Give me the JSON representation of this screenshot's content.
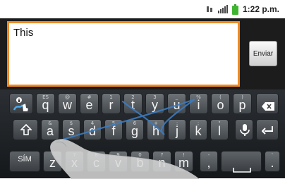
{
  "status_bar": {
    "time": "1:22 p.m."
  },
  "compose": {
    "message_text": "This",
    "send_label": "Enviar"
  },
  "keyboard": {
    "row1": [
      {
        "id": "q",
        "main": "q",
        "alt": "ES"
      },
      {
        "id": "w",
        "main": "w",
        "alt": "@"
      },
      {
        "id": "e",
        "main": "e",
        "alt": "#"
      },
      {
        "id": "r",
        "main": "r",
        "alt": "1"
      },
      {
        "id": "t",
        "main": "t",
        "alt": "2"
      },
      {
        "id": "y",
        "main": "y",
        "alt": "3"
      },
      {
        "id": "u",
        "main": "u",
        "alt": "_"
      },
      {
        "id": "i",
        "main": "i",
        "alt": "%"
      },
      {
        "id": "o",
        "main": "o",
        "alt": "("
      },
      {
        "id": "p",
        "main": "p",
        "alt": ")"
      }
    ],
    "row2": [
      {
        "id": "a",
        "main": "a",
        "alt": "&"
      },
      {
        "id": "s",
        "main": "s",
        "alt": "$"
      },
      {
        "id": "d",
        "main": "d",
        "alt": "4"
      },
      {
        "id": "f",
        "main": "f",
        "alt": "5"
      },
      {
        "id": "g",
        "main": "g",
        "alt": "6"
      },
      {
        "id": "h",
        "main": "h",
        "alt": "+"
      },
      {
        "id": "j",
        "main": "j",
        "alt": ":"
      },
      {
        "id": "k",
        "main": "k",
        "alt": ";"
      },
      {
        "id": "l",
        "main": "l",
        "alt": "\""
      }
    ],
    "row3": [
      {
        "id": "z",
        "main": "z",
        "alt": ""
      },
      {
        "id": "x",
        "main": "x",
        "alt": "7"
      },
      {
        "id": "c",
        "main": "c",
        "alt": "8"
      },
      {
        "id": "v",
        "main": "v",
        "alt": "9"
      },
      {
        "id": "b",
        "main": "b",
        "alt": "0"
      },
      {
        "id": "n",
        "main": "n",
        "alt": "?"
      },
      {
        "id": "m",
        "main": "m",
        "alt": "!"
      }
    ],
    "punct_comma": {
      "main": ",",
      "alt": "-"
    },
    "punct_period": {
      "main": ".",
      "alt": "'"
    },
    "sym_label": "SÍM",
    "icons": {
      "swype": "swype-info-icon",
      "backspace": "backspace-icon",
      "shift": "shift-icon",
      "mic": "microphone-icon",
      "enter": "enter-icon",
      "space": "space-icon"
    }
  }
}
